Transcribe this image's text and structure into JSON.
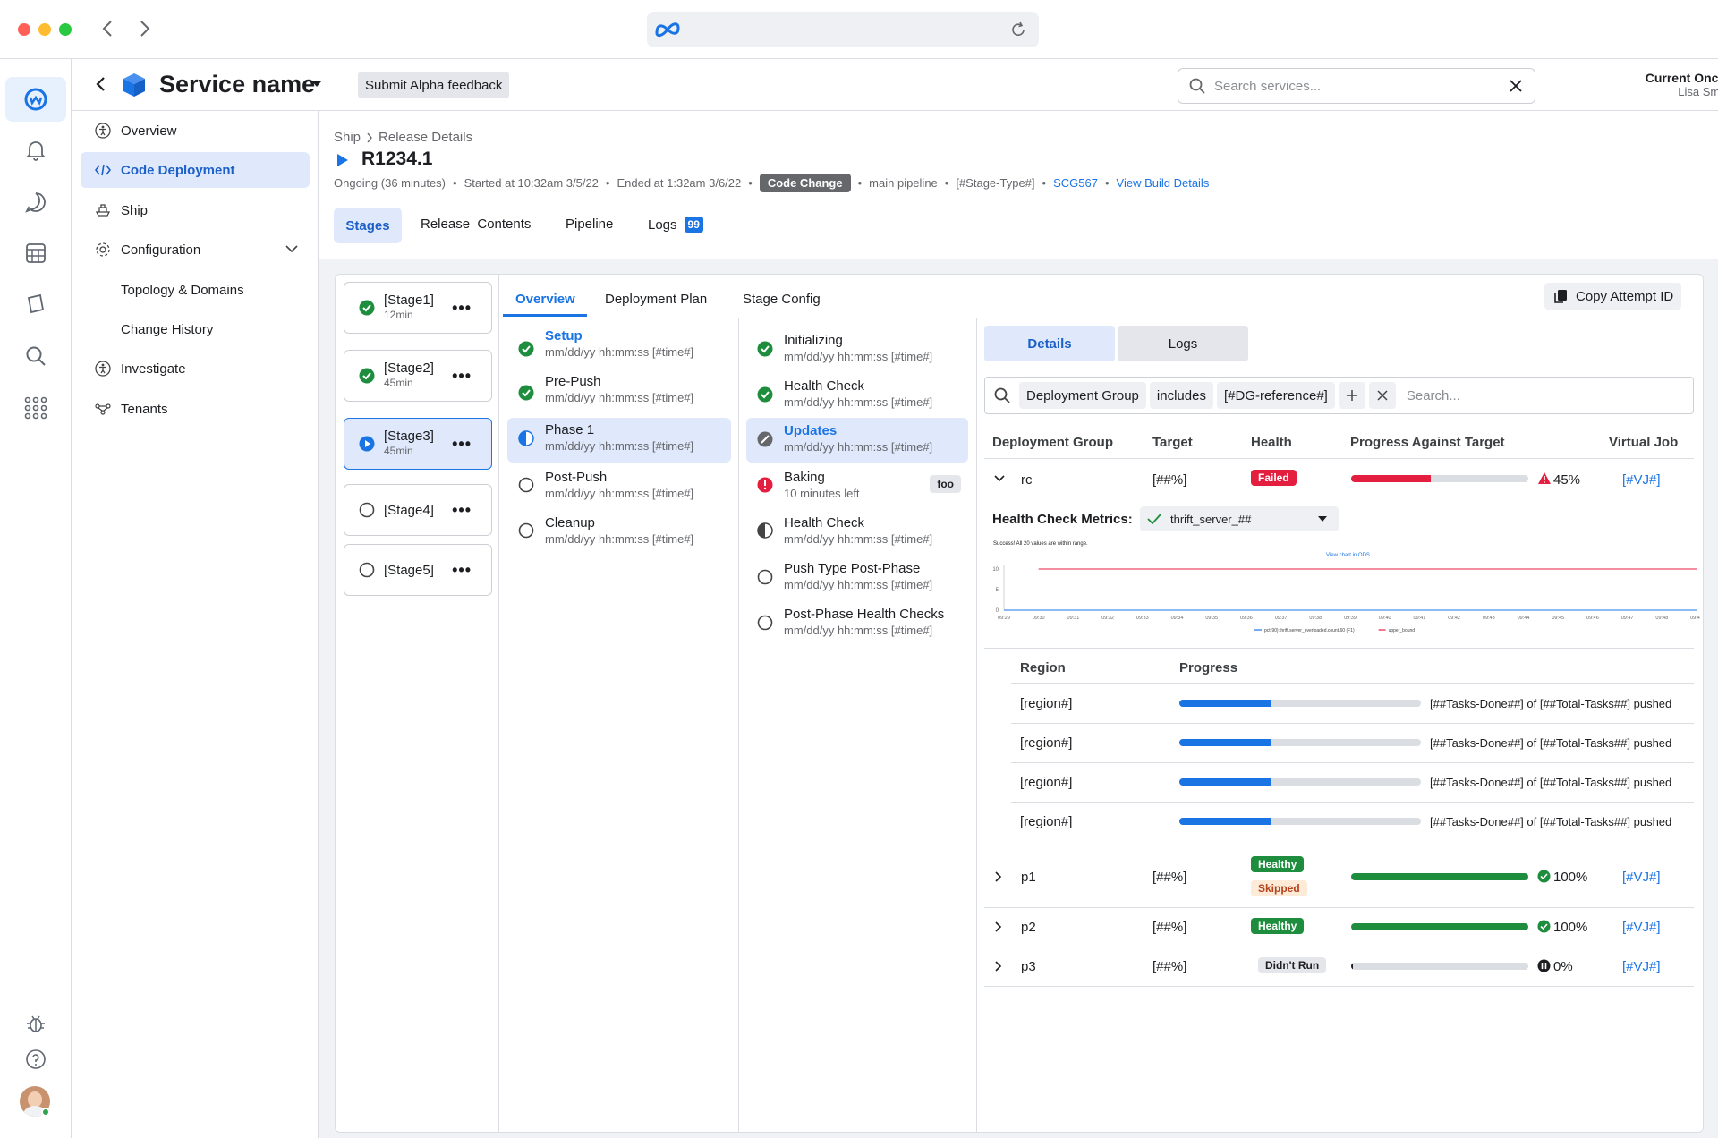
{
  "browser": {
    "url_icon": "meta-logo-icon"
  },
  "app": {
    "title": "Service name",
    "feedback": "Submit Alpha feedback",
    "search_placeholder": "Search services...",
    "oncall_label": "Current Oncall",
    "oncall_name": "Lisa Smith"
  },
  "sidebar": {
    "items": [
      {
        "label": "Overview"
      },
      {
        "label": "Code Deployment"
      },
      {
        "label": "Ship"
      },
      {
        "label": "Configuration"
      },
      {
        "label": "Topology & Domains"
      },
      {
        "label": "Change History"
      },
      {
        "label": "Investigate"
      },
      {
        "label": "Tenants"
      }
    ]
  },
  "header": {
    "crumb1": "Ship",
    "crumb2": "Release Details",
    "release": "R1234.1",
    "meta_ongoing": "Ongoing (36 minutes)",
    "meta_started": "Started at 10:32am 3/5/22",
    "meta_ended": "Ended at 1:32am 3/6/22",
    "badge": "Code Change",
    "meta_pipeline": "main pipeline",
    "meta_stagetype": "[#Stage-Type#]",
    "meta_scg": "SCG567",
    "meta_build": "View Build Details",
    "tabs": [
      "Stages",
      "Release  Contents",
      "Pipeline",
      "Logs"
    ],
    "logs_count": "99"
  },
  "stages": [
    {
      "name": "[Stage1]",
      "dur": "12min"
    },
    {
      "name": "[Stage2]",
      "dur": "45min"
    },
    {
      "name": "[Stage3]",
      "dur": "45min"
    },
    {
      "name": "[Stage4]",
      "dur": ""
    },
    {
      "name": "[Stage5]",
      "dur": ""
    }
  ],
  "inner_tabs": [
    "Overview",
    "Deployment Plan",
    "Stage Config"
  ],
  "copy_btn": "Copy Attempt ID",
  "phases": [
    {
      "name": "Setup",
      "time": "mm/dd/yy hh:mm:ss [#time#]"
    },
    {
      "name": "Pre-Push",
      "time": "mm/dd/yy hh:mm:ss [#time#]"
    },
    {
      "name": "Phase 1",
      "time": "mm/dd/yy hh:mm:ss [#time#]"
    },
    {
      "name": "Post-Push",
      "time": "mm/dd/yy hh:mm:ss [#time#]"
    },
    {
      "name": "Cleanup",
      "time": "mm/dd/yy hh:mm:ss [#time#]"
    }
  ],
  "steps": [
    {
      "name": "Initializing",
      "time": "mm/dd/yy hh:mm:ss [#time#]"
    },
    {
      "name": "Health Check",
      "time": "mm/dd/yy hh:mm:ss [#time#]"
    },
    {
      "name": "Updates",
      "time": "mm/dd/yy hh:mm:ss [#time#]"
    },
    {
      "name": "Baking",
      "time": "10 minutes left",
      "tag": "foo"
    },
    {
      "name": "Health Check",
      "time": "mm/dd/yy hh:mm:ss [#time#]"
    },
    {
      "name": "Push Type Post-Phase",
      "time": "mm/dd/yy hh:mm:ss [#time#]"
    },
    {
      "name": "Post-Phase Health Checks",
      "time": "mm/dd/yy hh:mm:ss [#time#]"
    }
  ],
  "details": {
    "tabs": [
      "Details",
      "Logs"
    ],
    "filter": {
      "field": "Deployment Group",
      "op": "includes",
      "value": "[#DG-reference#]",
      "placeholder": "Search..."
    },
    "columns": [
      "Deployment Group",
      "Target",
      "Health",
      "Progress Against Target",
      "Virtual Job"
    ],
    "metrics_label": "Health Check Metrics:",
    "metrics_select": "thrift_server_##",
    "chart_note": "Success! All 20 values are within range.",
    "chart_link": "View chart in ODS",
    "region_cols": [
      "Region",
      "Progress"
    ],
    "regions": [
      {
        "name": "[region#]",
        "progress": 0.38,
        "text": "[##Tasks-Done##] of [##Total-Tasks##] pushed"
      },
      {
        "name": "[region#]",
        "progress": 0.38,
        "text": "[##Tasks-Done##] of [##Total-Tasks##] pushed"
      },
      {
        "name": "[region#]",
        "progress": 0.38,
        "text": "[##Tasks-Done##] of [##Total-Tasks##] pushed"
      },
      {
        "name": "[region#]",
        "progress": 0.38,
        "text": "[##Tasks-Done##] of [##Total-Tasks##] pushed"
      }
    ],
    "groups": [
      {
        "name": "rc",
        "target": "[##%]",
        "health": "Failed",
        "health2": "",
        "pct_label": "45%",
        "job": "[#VJ#]",
        "progress": 0.45
      },
      {
        "name": "p1",
        "target": "[##%]",
        "health": "Healthy",
        "health2": "Skipped",
        "pct_label": "100%",
        "job": "[#VJ#]",
        "progress": 1.0
      },
      {
        "name": "p2",
        "target": "[##%]",
        "health": "Healthy",
        "health2": "",
        "pct_label": "100%",
        "job": "[#VJ#]",
        "progress": 1.0
      },
      {
        "name": "p3",
        "target": "[##%]",
        "health": "Didn't Run",
        "health2": "",
        "pct_label": "0%",
        "job": "[#VJ#]",
        "progress": 0.0
      }
    ]
  },
  "chart_data": {
    "type": "line",
    "x": [
      "09:29",
      "09:30",
      "09:31",
      "09:32",
      "09:33",
      "09:34",
      "09:35",
      "09:36",
      "09:37",
      "09:38",
      "09:39",
      "09:40",
      "09:41",
      "09:42",
      "09:43",
      "09:44",
      "09:45",
      "09:46",
      "09:47",
      "09:48",
      "09:49"
    ],
    "ylim": [
      0,
      10
    ],
    "yticks": [
      0,
      5,
      10
    ],
    "series": [
      {
        "name": "pct(90):thrift.server_overloaded.count.60 (F1)",
        "color": "#1b74e4",
        "values": [
          0,
          0,
          0,
          0,
          0,
          0,
          0,
          0,
          0,
          0,
          0,
          0,
          0,
          0,
          0,
          0,
          0,
          0,
          0,
          0,
          0
        ]
      },
      {
        "name": "upper_bound",
        "color": "#e41e3f",
        "values": [
          10,
          10,
          10,
          10,
          10,
          10,
          10,
          10,
          10,
          10,
          10,
          10,
          10,
          10,
          10,
          10,
          10,
          10,
          10,
          10,
          10
        ]
      }
    ]
  },
  "colors": {
    "accent": "#1b74e4",
    "success": "#1e8e3e",
    "danger": "#e41e3f"
  }
}
